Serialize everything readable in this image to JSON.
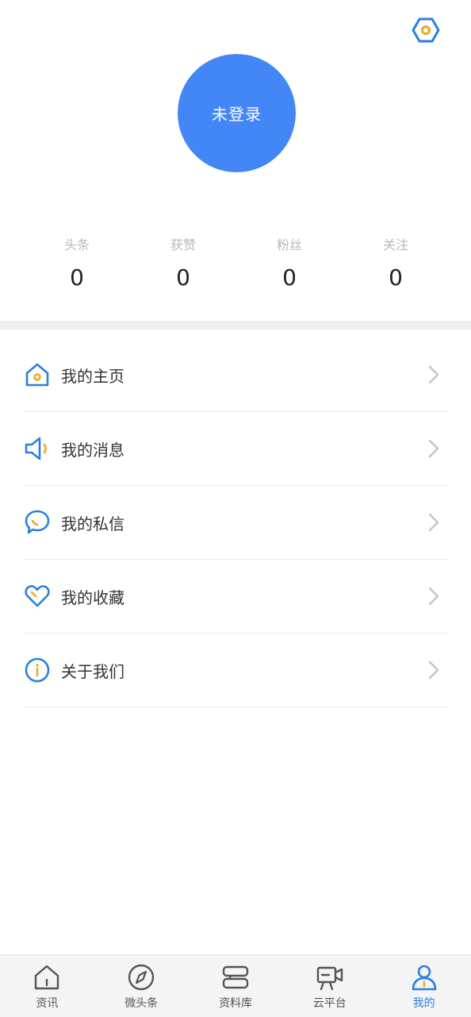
{
  "colors": {
    "accent": "#2a7fe0",
    "avatar_bg": "#4287f5",
    "orange": "#f5a623",
    "text_primary": "#333333",
    "text_muted": "#b9b9b9"
  },
  "header": {
    "settings_icon": "settings-hexagon-icon"
  },
  "profile": {
    "avatar_label": "未登录"
  },
  "stats": [
    {
      "label": "头条",
      "value": "0"
    },
    {
      "label": "获赞",
      "value": "0"
    },
    {
      "label": "粉丝",
      "value": "0"
    },
    {
      "label": "关注",
      "value": "0"
    }
  ],
  "menu": [
    {
      "label": "我的主页",
      "icon": "home-icon"
    },
    {
      "label": "我的消息",
      "icon": "speaker-icon"
    },
    {
      "label": "我的私信",
      "icon": "chat-bubble-icon"
    },
    {
      "label": "我的收藏",
      "icon": "heart-icon"
    },
    {
      "label": "关于我们",
      "icon": "info-icon"
    }
  ],
  "tabs": [
    {
      "label": "资讯",
      "icon": "house-icon",
      "active": false
    },
    {
      "label": "微头条",
      "icon": "compass-icon",
      "active": false
    },
    {
      "label": "资料库",
      "icon": "library-icon",
      "active": false
    },
    {
      "label": "云平台",
      "icon": "video-camera-icon",
      "active": false
    },
    {
      "label": "我的",
      "icon": "person-icon",
      "active": true
    }
  ]
}
